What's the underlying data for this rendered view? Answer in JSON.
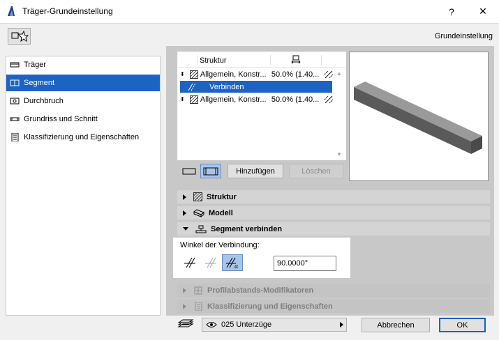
{
  "window": {
    "title": "Träger-Grundeinstellung",
    "help_label": "?",
    "close_label": "✕"
  },
  "header": {
    "label": "Grundeinstellung"
  },
  "nav": {
    "items": [
      {
        "label": "Träger",
        "icon": "beam-icon",
        "selected": false
      },
      {
        "label": "Segment",
        "icon": "segment-icon",
        "selected": true
      },
      {
        "label": "Durchbruch",
        "icon": "opening-icon",
        "selected": false
      },
      {
        "label": "Grundriss und Schnitt",
        "icon": "floorplan-icon",
        "selected": false
      },
      {
        "label": "Klassifizierung und Eigenschaften",
        "icon": "document-icon",
        "selected": false
      }
    ]
  },
  "segments": {
    "columns": {
      "structure": "Struktur"
    },
    "rows": [
      {
        "name": "Allgemein, Konstr...",
        "value": "50.0% (1.40..."
      },
      {
        "name": "Verbinden"
      },
      {
        "name": "Allgemein, Konstr...",
        "value": "50.0% (1.40..."
      }
    ],
    "add_label": "Hinzufügen",
    "delete_label": "Löschen"
  },
  "sections": {
    "structure": "Struktur",
    "model": "Modell",
    "connect": "Segment verbinden",
    "profile_offset": "Profilabstands-Modifikatoren",
    "classification": "Klassifizierung und Eigenschaften"
  },
  "connect_panel": {
    "angle_label": "Winkel der Verbindung:",
    "angle_value": "90.0000°"
  },
  "footer": {
    "layer_name": "025 Unterzüge",
    "cancel_label": "Abbrechen",
    "ok_label": "OK"
  },
  "colors": {
    "accent": "#1d63c2",
    "section_bg": "#d4d4d4",
    "panel_bg": "#c8c8c8"
  }
}
